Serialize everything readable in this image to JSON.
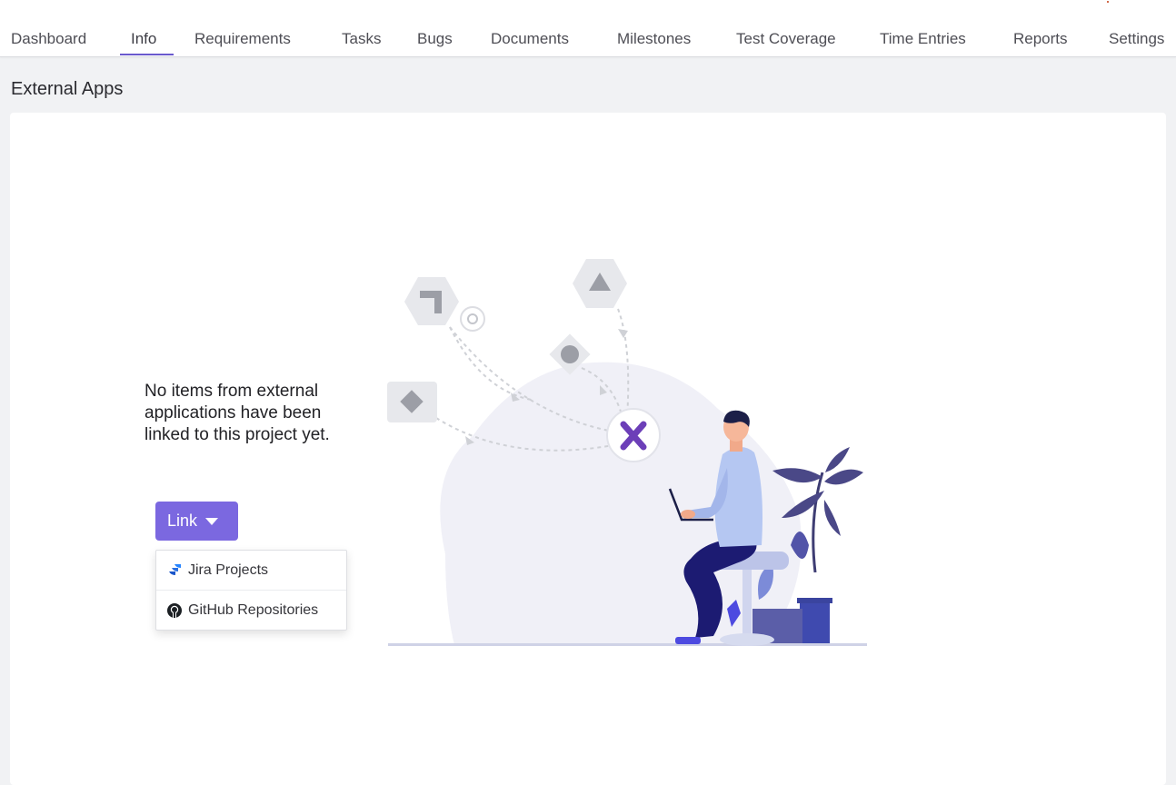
{
  "nav": {
    "tabs": [
      {
        "label": "Dashboard"
      },
      {
        "label": "Info"
      },
      {
        "label": "Requirements"
      },
      {
        "label": "Tasks"
      },
      {
        "label": "Bugs"
      },
      {
        "label": "Documents"
      },
      {
        "label": "Milestones"
      },
      {
        "label": "Test Coverage"
      },
      {
        "label": "Time Entries"
      },
      {
        "label": "Reports"
      },
      {
        "label": "Settings"
      }
    ],
    "active_tab": "Info"
  },
  "section": {
    "title": "External Apps"
  },
  "empty_state": {
    "message": "No items from external applications have been linked to this project yet."
  },
  "link_button": {
    "label": "Link",
    "menu": [
      {
        "label": "Jira Projects",
        "icon": "jira-icon"
      },
      {
        "label": "GitHub Repositories",
        "icon": "github-icon"
      }
    ]
  },
  "illustration": {
    "center_logo_text": "X"
  },
  "colors": {
    "accent": "#7b68e0",
    "tab_underline": "#6a5acd",
    "panel_bg": "#ffffff",
    "page_bg": "#f1f2f4"
  }
}
